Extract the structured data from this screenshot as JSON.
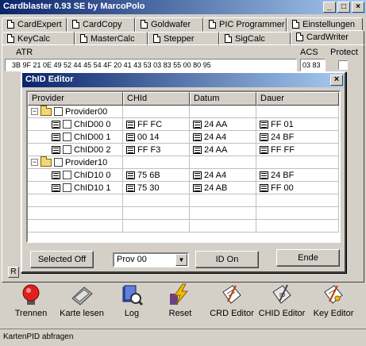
{
  "window": {
    "title": "Cardblaster 0.93 SE by MarcoPolo"
  },
  "tabs_row1": [
    "CardExpert",
    "CardCopy",
    "Goldwafer",
    "PIC Programmer",
    "Einstellungen"
  ],
  "tabs_row2": [
    "KeyCalc",
    "MasterCalc",
    "Stepper",
    "SigCalc",
    "CardWriter"
  ],
  "background": {
    "atr_label": "ATR",
    "atr_value": "3B 9F 21 0E 49 52 44 45 54 4F 20 41 43 53 03 83 55 00 80 95",
    "acs_label": "ACS",
    "acs_value": "03 83",
    "protect_label": "Protect",
    "r_label": "R"
  },
  "dialog": {
    "title": "ChID Editor",
    "columns": [
      "Provider",
      "CHId",
      "Datum",
      "Dauer"
    ],
    "rows": [
      {
        "provider": "Provider00",
        "chid": "",
        "datum": "",
        "dauer": ""
      },
      {
        "provider": "ChID00 0",
        "chid": "FF FC",
        "datum": "24 AA",
        "dauer": "FF 01"
      },
      {
        "provider": "ChID00 1",
        "chid": "00 14",
        "datum": "24 A4",
        "dauer": "24 BF"
      },
      {
        "provider": "ChID00 2",
        "chid": "FF F3",
        "datum": "24 AA",
        "dauer": "FF FF"
      },
      {
        "provider": "Provider10",
        "chid": "",
        "datum": "",
        "dauer": ""
      },
      {
        "provider": "ChID10 0",
        "chid": "75 6B",
        "datum": "24 A4",
        "dauer": "24 BF"
      },
      {
        "provider": "ChID10 1",
        "chid": "75 30",
        "datum": "24 AB",
        "dauer": "FF 00"
      }
    ],
    "expander_symbol": "−",
    "buttons": {
      "selected_off": "Selected Off",
      "provider_select": "Prov 00",
      "id_on": "ID On",
      "ende": "Ende"
    }
  },
  "toolbar": {
    "trennen": "Trennen",
    "karte_lesen": "Karte lesen",
    "log": "Log",
    "reset": "Reset",
    "crd_editor": "CRD Editor",
    "chid_editor": "CHID Editor",
    "key_editor": "Key Editor"
  },
  "status": {
    "text": "KartenPID abfragen"
  },
  "icons": {
    "page": "page-icon",
    "folder": "folder-icon",
    "stop": "stop-light-icon",
    "card": "card-reader-icon",
    "log": "log-file-icon",
    "reset": "lightning-icon",
    "crd": "document-edit-icon",
    "chid": "chid-document-icon",
    "key": "key-document-icon"
  },
  "colors": {
    "titlebar_start": "#0a246a",
    "titlebar_end": "#a6caf0",
    "stop_red": "#e02020",
    "lightning": "#f0c000"
  }
}
